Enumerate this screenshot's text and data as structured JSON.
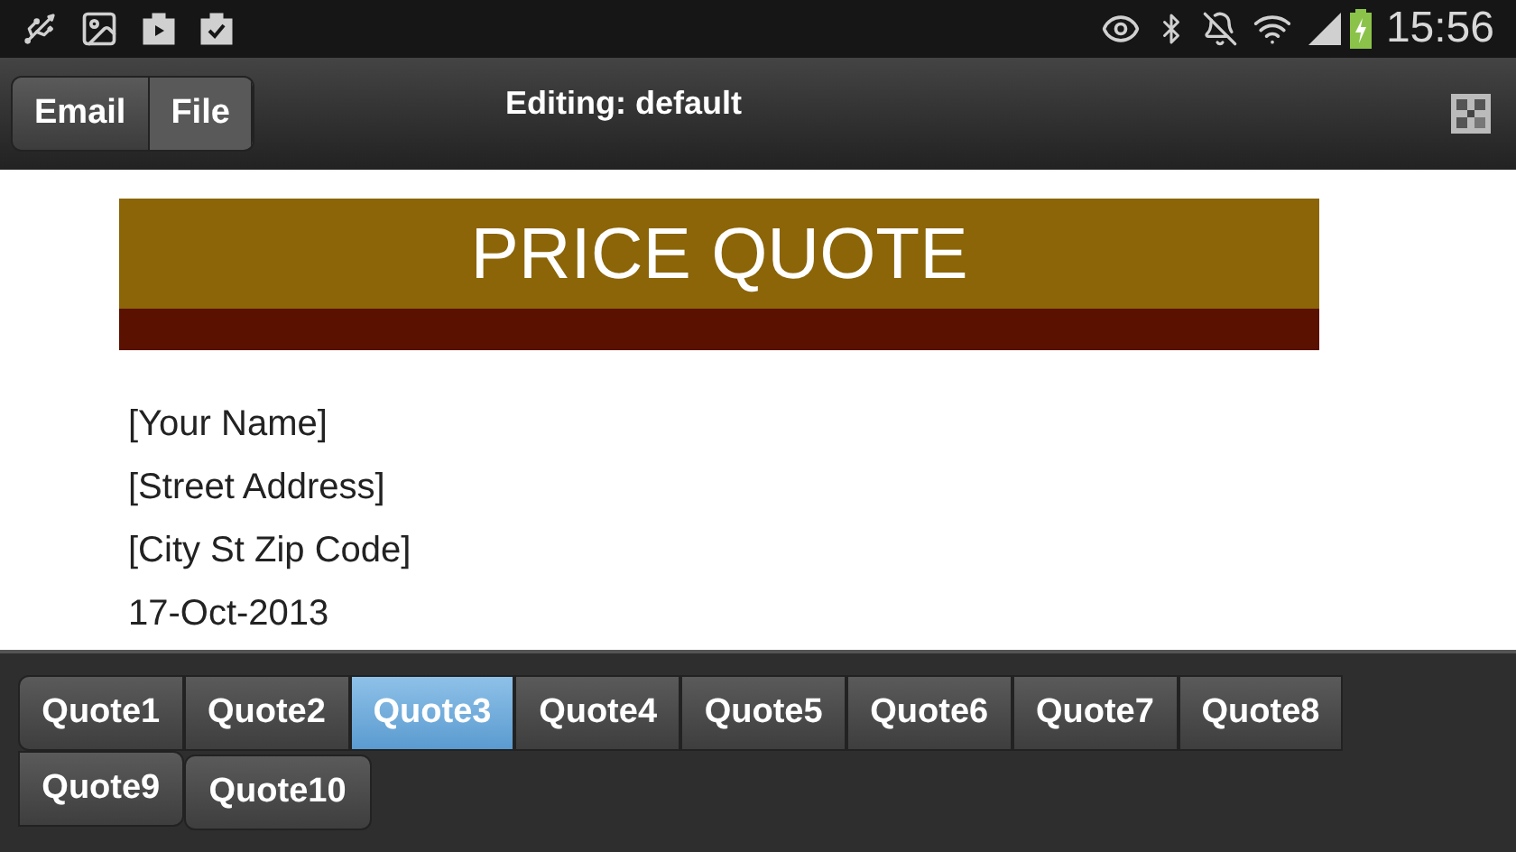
{
  "status_bar": {
    "time": "15:56"
  },
  "action_bar": {
    "buttons": [
      {
        "label": "Email",
        "selected": false
      },
      {
        "label": "File",
        "selected": true
      }
    ],
    "title": "Editing: default"
  },
  "document": {
    "banner_title": "PRICE QUOTE",
    "lines": [
      "[Your Name]",
      "[Street Address]",
      "[City St Zip Code]",
      "17-Oct-2013"
    ]
  },
  "quote_tabs": [
    {
      "label": "Quote1",
      "selected": false
    },
    {
      "label": "Quote2",
      "selected": false
    },
    {
      "label": "Quote3",
      "selected": true
    },
    {
      "label": "Quote4",
      "selected": false
    },
    {
      "label": "Quote5",
      "selected": false
    },
    {
      "label": "Quote6",
      "selected": false
    },
    {
      "label": "Quote7",
      "selected": false
    },
    {
      "label": "Quote8",
      "selected": false
    },
    {
      "label": "Quote9",
      "selected": false
    },
    {
      "label": "Quote10",
      "selected": false
    }
  ]
}
